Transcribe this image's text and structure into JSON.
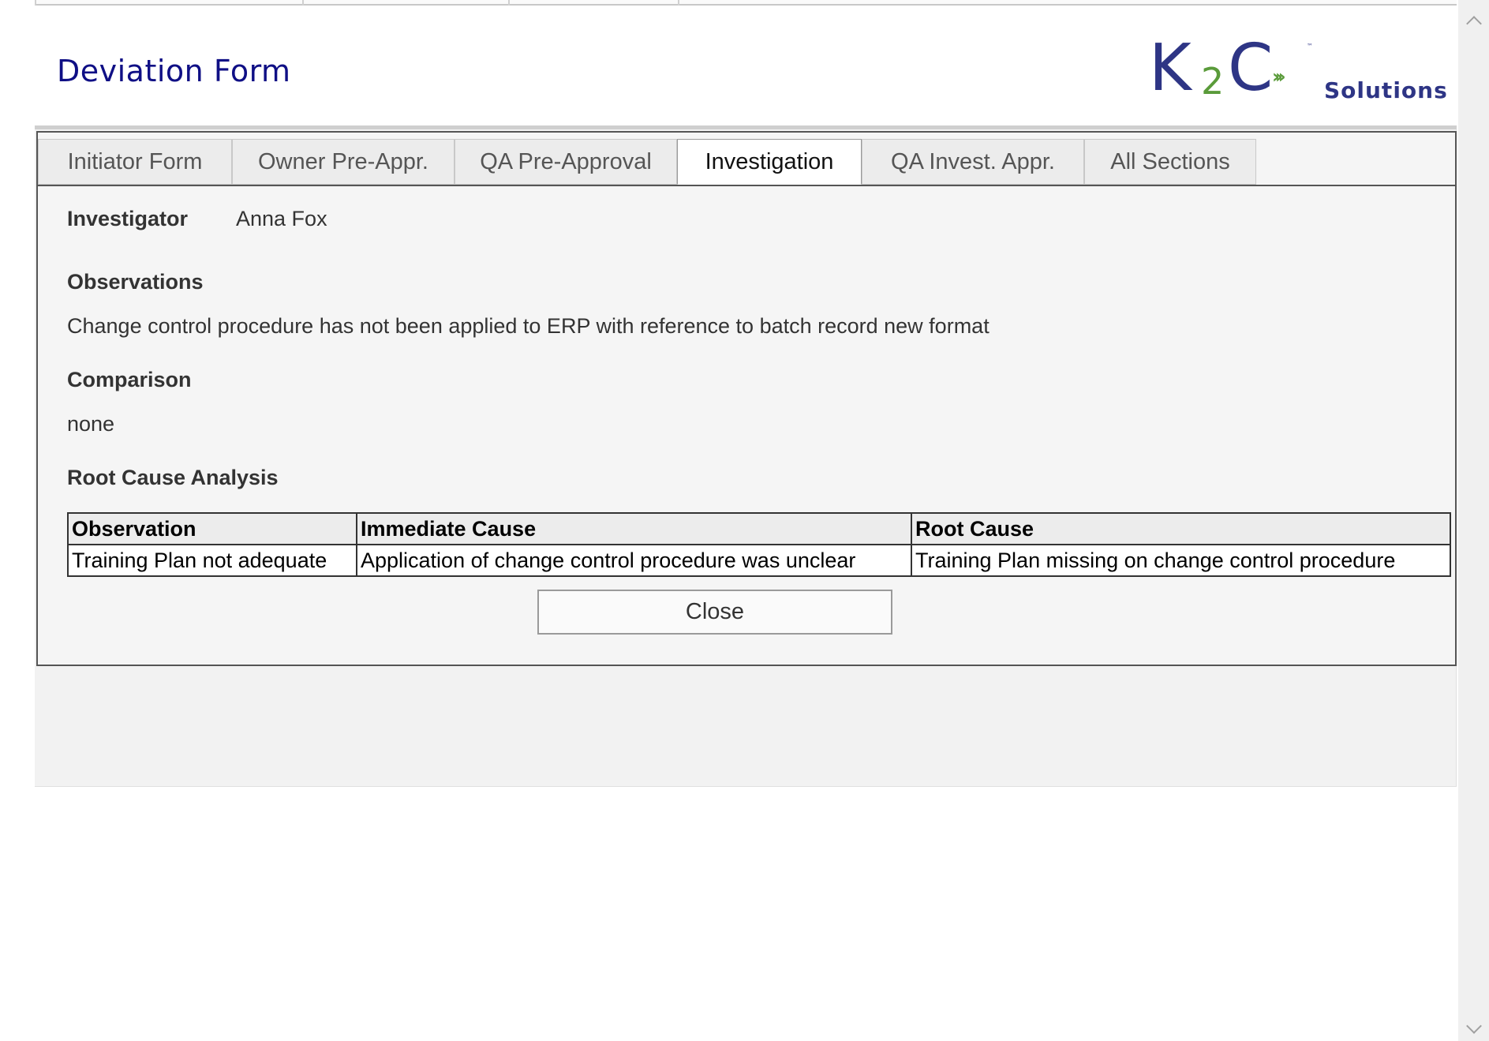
{
  "header": {
    "title": "Deviation Form",
    "logo": {
      "k": "K",
      "two": "2",
      "c": "C",
      "arrows": "›››",
      "tm": "™",
      "solutions": "Solutions"
    }
  },
  "tabs": [
    {
      "label": "Initiator Form",
      "active": false
    },
    {
      "label": "Owner Pre-Appr.",
      "active": false
    },
    {
      "label": "QA Pre-Approval",
      "active": false
    },
    {
      "label": "Investigation",
      "active": true
    },
    {
      "label": "QA Invest. Appr.",
      "active": false
    },
    {
      "label": "All Sections",
      "active": false
    }
  ],
  "investigation": {
    "investigator_label": "Investigator",
    "investigator_value": "Anna Fox",
    "observations_label": "Observations",
    "observations_value": "Change control procedure has not been applied to ERP with reference to batch record new format",
    "comparison_label": "Comparison",
    "comparison_value": "none",
    "rca_label": "Root Cause Analysis",
    "rca_table": {
      "headers": [
        "Observation",
        "Immediate Cause",
        "Root Cause"
      ],
      "rows": [
        [
          "Training Plan not adequate",
          "Application of change control procedure was unclear",
          "Training Plan missing on change control procedure"
        ]
      ]
    }
  },
  "actions": {
    "close_label": "Close"
  },
  "colors": {
    "title": "#0f0f85",
    "logo_blue": "#2e3585",
    "logo_green": "#5a9b3a"
  },
  "icons": {
    "scroll_up": "chevron-up-icon",
    "scroll_down": "chevron-down-icon",
    "logo_arrows": "fast-forward-icon"
  }
}
